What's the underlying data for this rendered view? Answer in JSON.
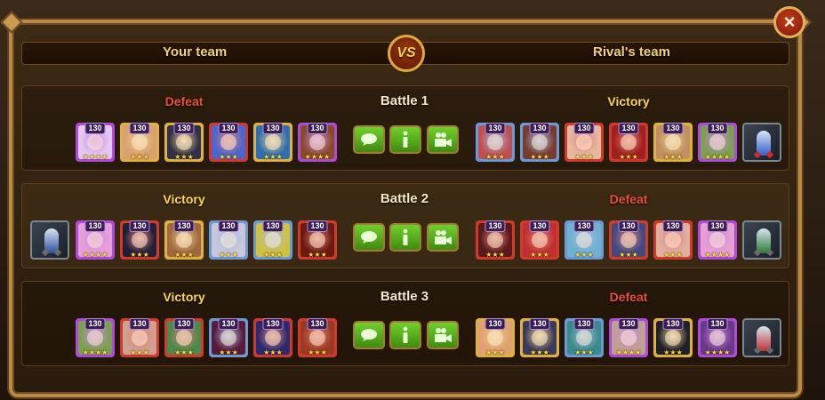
{
  "header": {
    "your_team": "Your team",
    "rivals_team": "Rival's team",
    "vs": "VS",
    "close": "×"
  },
  "colors": {
    "victory": "#ffd84a",
    "defeat": "#e8503a",
    "button_green": "#5cb81f",
    "frame_gold": "#b98a45"
  },
  "battles": [
    {
      "title": "Battle 1",
      "your_result": "Defeat",
      "rival_result": "Victory",
      "your_heroes": [
        {
          "level": "130",
          "stars": "★★★★",
          "border": "purple",
          "tint": "#e4c8f0"
        },
        {
          "level": "130",
          "stars": "★★★",
          "border": "gold",
          "tint": "#d9a070"
        },
        {
          "level": "130",
          "stars": "★★★",
          "border": "gold",
          "tint": "#30304a"
        },
        {
          "level": "130",
          "stars": "★★★",
          "border": "red",
          "tint": "#4a66d0"
        },
        {
          "level": "130",
          "stars": "★★★",
          "border": "gold",
          "tint": "#2f6fb0"
        },
        {
          "level": "130",
          "stars": "★★★★",
          "border": "purple",
          "tint": "#8a4a2a"
        }
      ],
      "rival_heroes": [
        {
          "level": "130",
          "stars": "★★★",
          "border": "blue",
          "tint": "#c05050"
        },
        {
          "level": "130",
          "stars": "★★★",
          "border": "blue",
          "tint": "#7a3a30"
        },
        {
          "level": "130",
          "stars": "★★★",
          "border": "red",
          "tint": "#e6b8a0"
        },
        {
          "level": "130",
          "stars": "★★★",
          "border": "red",
          "tint": "#a02020"
        },
        {
          "level": "130",
          "stars": "★★★",
          "border": "gold",
          "tint": "#c09060"
        },
        {
          "level": "130",
          "stars": "★★★★",
          "border": "purple",
          "tint": "#7aa050"
        }
      ],
      "rival_pet": {
        "tint": "#3060d0",
        "gem": "#d02a2a"
      }
    },
    {
      "title": "Battle 2",
      "your_result": "Victory",
      "rival_result": "Defeat",
      "your_pet": {
        "tint": "#3050a0",
        "gem": "#6a6a6a"
      },
      "your_heroes": [
        {
          "level": "130",
          "stars": "★★★★",
          "border": "purple",
          "tint": "#e6a0d8"
        },
        {
          "level": "130",
          "stars": "★★★",
          "border": "red",
          "tint": "#20203a"
        },
        {
          "level": "130",
          "stars": "★★★",
          "border": "gold",
          "tint": "#a06a40"
        },
        {
          "level": "130",
          "stars": "★★★",
          "border": "blue",
          "tint": "#c8c8d8"
        },
        {
          "level": "130",
          "stars": "★★★",
          "border": "blue",
          "tint": "#d0c040"
        },
        {
          "level": "130",
          "stars": "★★★",
          "border": "red",
          "tint": "#6a1a10"
        }
      ],
      "rival_heroes": [
        {
          "level": "130",
          "stars": "★★★",
          "border": "red",
          "tint": "#5a1a1a"
        },
        {
          "level": "130",
          "stars": "★★★",
          "border": "red",
          "tint": "#c03030"
        },
        {
          "level": "130",
          "stars": "★★★",
          "border": "blue",
          "tint": "#70b0d0"
        },
        {
          "level": "130",
          "stars": "★★★",
          "border": "red",
          "tint": "#404a80"
        },
        {
          "level": "130",
          "stars": "★★★",
          "border": "red",
          "tint": "#e0b0a0"
        },
        {
          "level": "130",
          "stars": "★★★★",
          "border": "purple",
          "tint": "#e8a0d0"
        }
      ],
      "rival_pet": {
        "tint": "#2a7a30",
        "gem": "#6a6a6a"
      }
    },
    {
      "title": "Battle 3",
      "your_result": "Victory",
      "rival_result": "Defeat",
      "your_heroes": [
        {
          "level": "130",
          "stars": "★★★★",
          "border": "purple",
          "tint": "#7aa050"
        },
        {
          "level": "130",
          "stars": "★★★",
          "border": "red",
          "tint": "#d0a090"
        },
        {
          "level": "130",
          "stars": "★★★",
          "border": "red",
          "tint": "#4a8a4a"
        },
        {
          "level": "130",
          "stars": "★★★",
          "border": "blue",
          "tint": "#5a1a3a"
        },
        {
          "level": "130",
          "stars": "★★★",
          "border": "red",
          "tint": "#2a2a70"
        },
        {
          "level": "130",
          "stars": "★★★",
          "border": "red",
          "tint": "#9a3a20"
        }
      ],
      "rival_heroes": [
        {
          "level": "130",
          "stars": "★★★",
          "border": "gold",
          "tint": "#e0a070"
        },
        {
          "level": "130",
          "stars": "★★★",
          "border": "gold",
          "tint": "#3a3a5a"
        },
        {
          "level": "130",
          "stars": "★★★",
          "border": "blue",
          "tint": "#3a8a8a"
        },
        {
          "level": "130",
          "stars": "★★★★",
          "border": "purple",
          "tint": "#c0a090"
        },
        {
          "level": "130",
          "stars": "★★★",
          "border": "gold",
          "tint": "#20202a"
        },
        {
          "level": "130",
          "stars": "★★★★",
          "border": "purple",
          "tint": "#6a3a8a"
        }
      ],
      "rival_pet": {
        "tint": "#c03030",
        "gem": "#6a6a6a"
      }
    }
  ],
  "icons": {
    "chat": "chat-bubble-icon",
    "info": "info-icon",
    "replay": "video-camera-icon"
  }
}
